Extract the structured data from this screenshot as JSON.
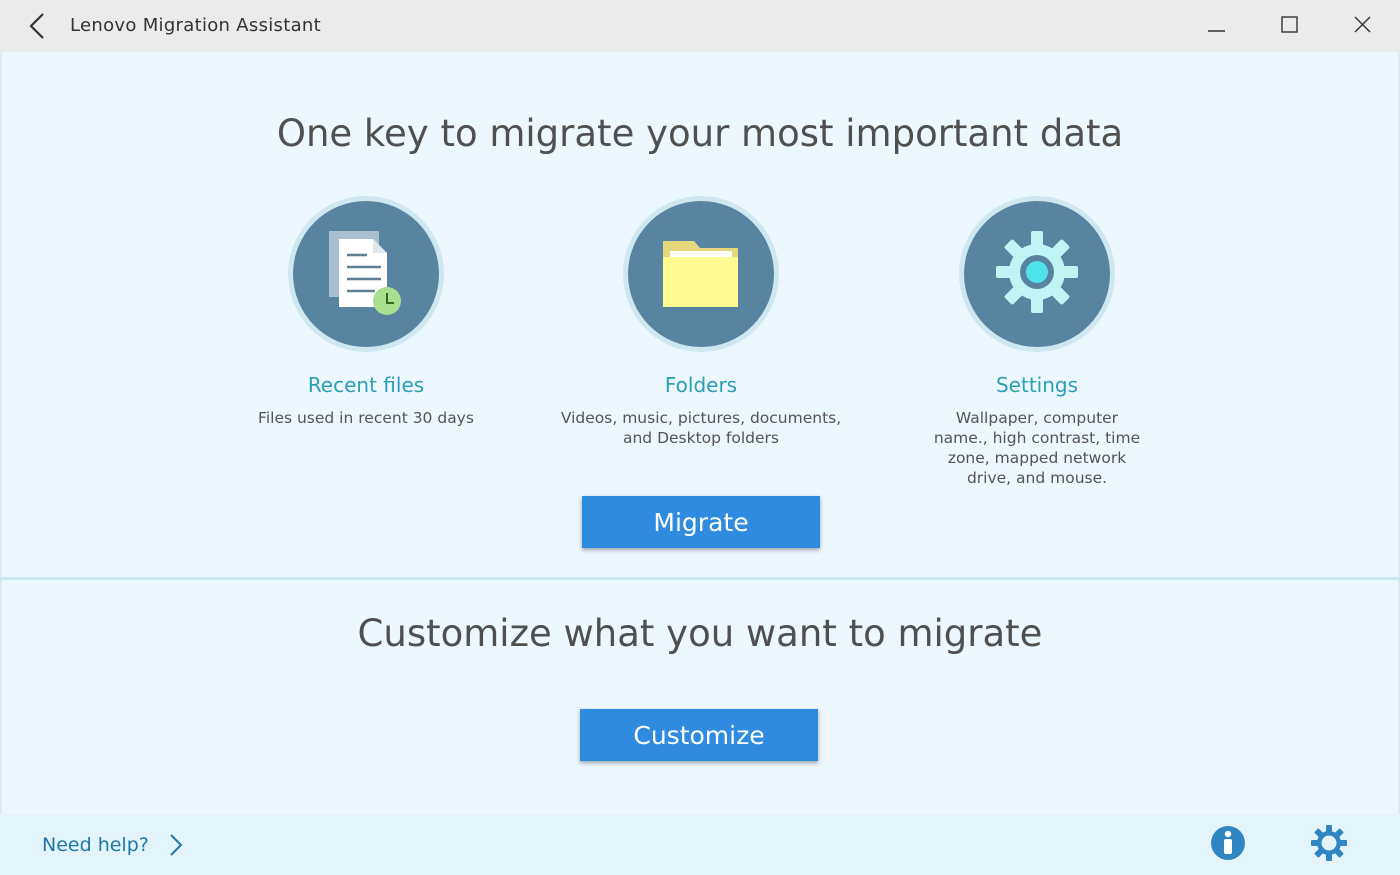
{
  "window": {
    "title": "Lenovo Migration Assistant"
  },
  "hero": {
    "heading": "One key to migrate your most important data",
    "categories": [
      {
        "title": "Recent files",
        "description": "Files used in recent 30 days",
        "icon": "recent-files-icon"
      },
      {
        "title": "Folders",
        "description": "Videos, music, pictures, documents, and Desktop folders",
        "icon": "folder-icon"
      },
      {
        "title": "Settings",
        "description": "Wallpaper, computer name., high contrast, time zone, mapped network drive, and mouse.",
        "icon": "settings-gear-icon"
      }
    ],
    "migrate_label": "Migrate"
  },
  "customize": {
    "heading": "Customize what you want to migrate",
    "button_label": "Customize"
  },
  "footer": {
    "help_label": "Need help?"
  },
  "colors": {
    "accent": "#2f8be0",
    "link": "#2a9fb6",
    "icon_bg": "#5785a1"
  }
}
